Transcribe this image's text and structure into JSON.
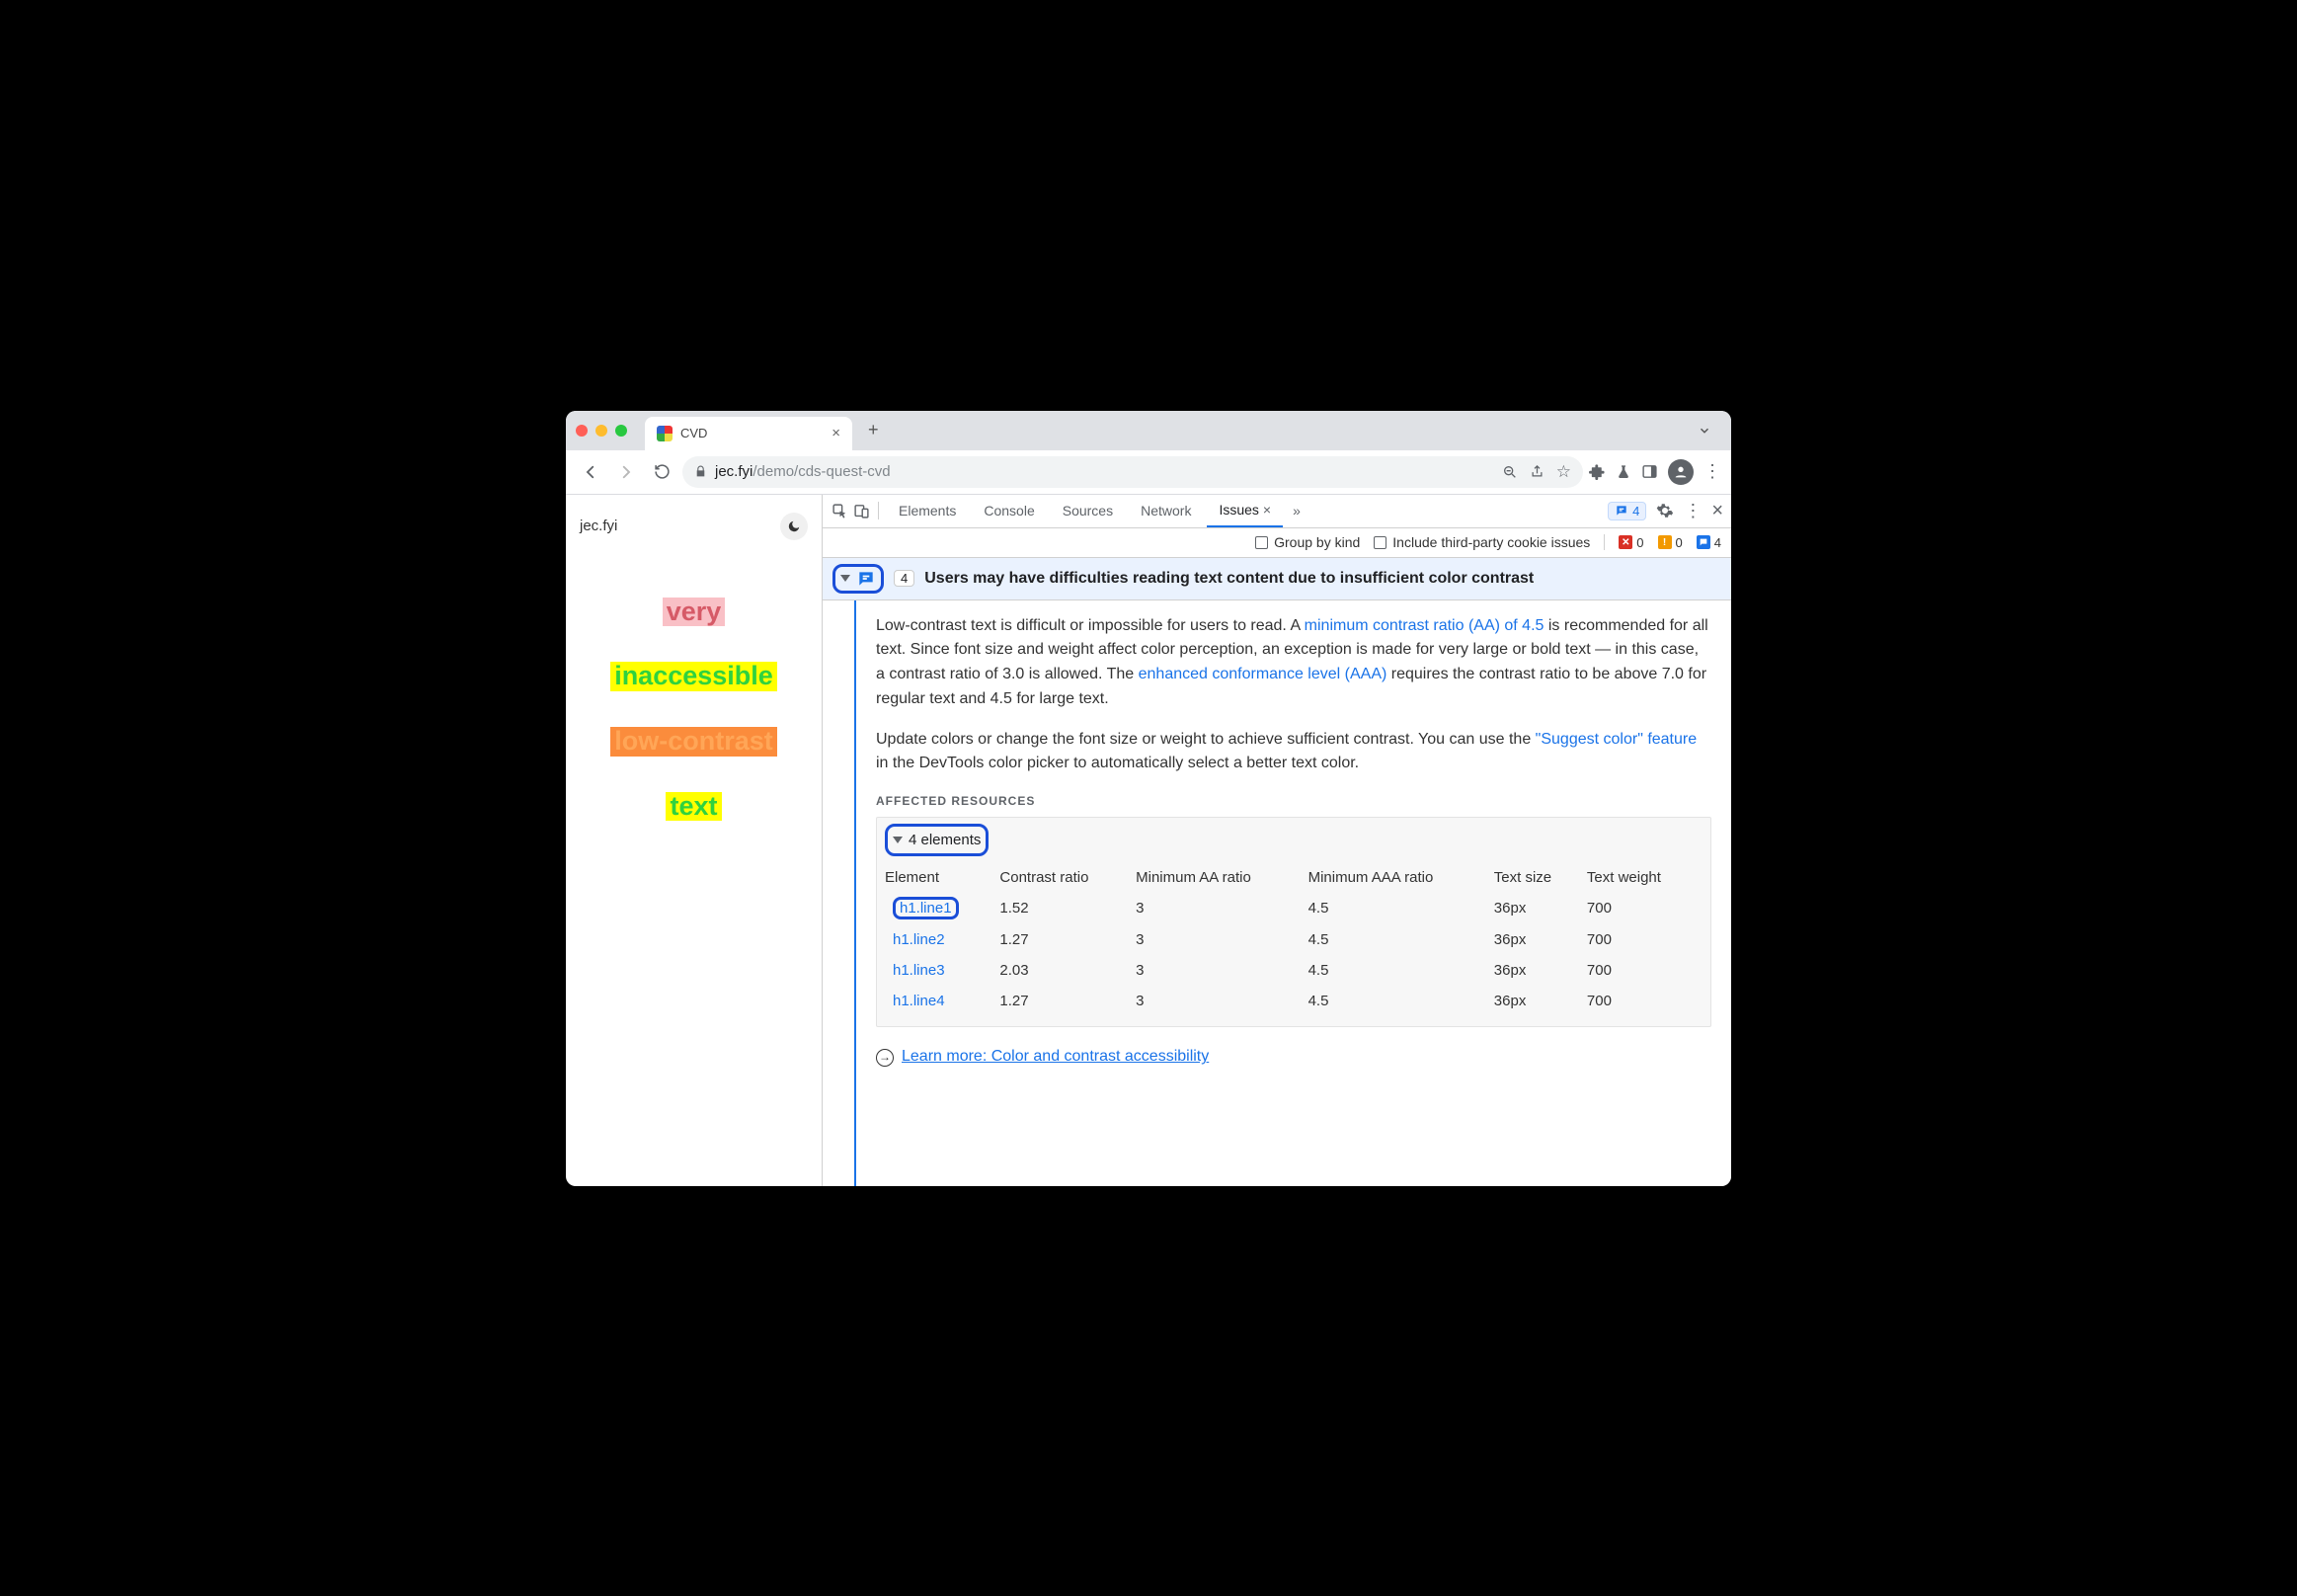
{
  "browser": {
    "tab_title": "CVD",
    "url_domain": "jec.fyi",
    "url_path": "/demo/cds-quest-cvd"
  },
  "page": {
    "site_title": "jec.fyi",
    "lines": [
      "very",
      "inaccessible",
      "low-contrast",
      "text"
    ]
  },
  "devtools": {
    "tabs": [
      "Elements",
      "Console",
      "Sources",
      "Network",
      "Issues"
    ],
    "active_tab": "Issues",
    "issues_count": "4",
    "subbar": {
      "group_label": "Group by kind",
      "thirdparty_label": "Include third-party cookie issues",
      "err_count": "0",
      "warn_count": "0",
      "info_count": "4"
    }
  },
  "issue": {
    "count": "4",
    "title": "Users may have difficulties reading text content due to insufficient color contrast",
    "para1_a": "Low-contrast text is difficult or impossible for users to read. A ",
    "link_aa": "minimum contrast ratio (AA) of 4.5",
    "para1_b": " is recommended for all text. Since font size and weight affect color perception, an exception is made for very large or bold text — in this case, a contrast ratio of 3.0 is allowed. The ",
    "link_aaa": "enhanced conformance level (AAA)",
    "para1_c": " requires the contrast ratio to be above 7.0 for regular text and 4.5 for large text.",
    "para2_a": "Update colors or change the font size or weight to achieve sufficient contrast. You can use the ",
    "link_suggest": "\"Suggest color\" feature",
    "para2_b": " in the DevTools color picker to automatically select a better text color.",
    "section_label": "AFFECTED RESOURCES",
    "elements_summary": "4 elements",
    "columns": [
      "Element",
      "Contrast ratio",
      "Minimum AA ratio",
      "Minimum AAA ratio",
      "Text size",
      "Text weight"
    ],
    "rows": [
      {
        "el": "h1.line1",
        "cr": "1.52",
        "aa": "3",
        "aaa": "4.5",
        "size": "36px",
        "weight": "700"
      },
      {
        "el": "h1.line2",
        "cr": "1.27",
        "aa": "3",
        "aaa": "4.5",
        "size": "36px",
        "weight": "700"
      },
      {
        "el": "h1.line3",
        "cr": "2.03",
        "aa": "3",
        "aaa": "4.5",
        "size": "36px",
        "weight": "700"
      },
      {
        "el": "h1.line4",
        "cr": "1.27",
        "aa": "3",
        "aaa": "4.5",
        "size": "36px",
        "weight": "700"
      }
    ],
    "learn_more": "Learn more: Color and contrast accessibility"
  }
}
